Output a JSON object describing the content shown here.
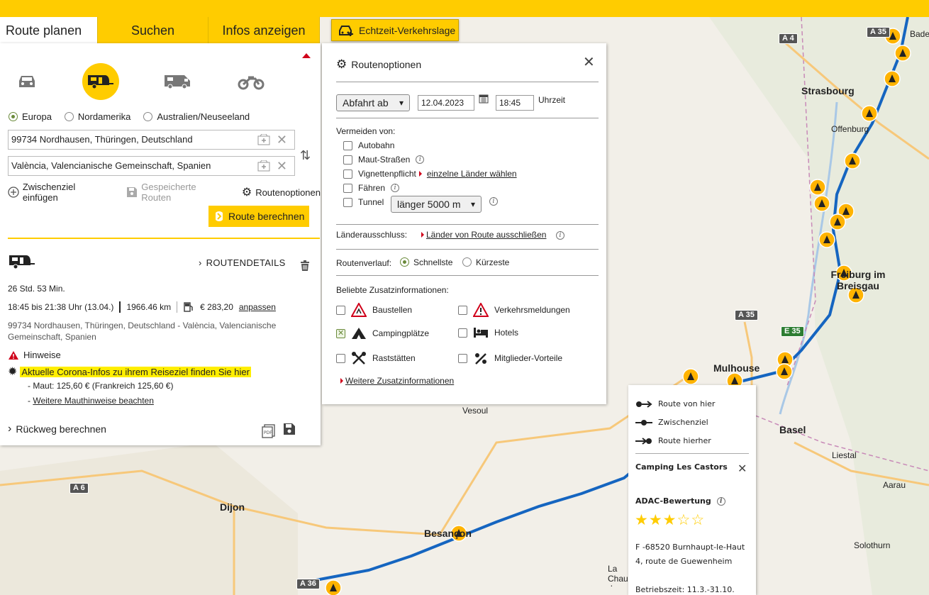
{
  "tabs": [
    {
      "label": "Route planen"
    },
    {
      "label": "Suchen"
    },
    {
      "label": "Infos anzeigen"
    }
  ],
  "traffic_button": {
    "label": "Echtzeit-Verkehrslage",
    "icon": "traffic-car-icon"
  },
  "planner": {
    "vehicles": [
      "car-icon",
      "caravan-icon",
      "motorhome-icon",
      "motorcycle-icon"
    ],
    "active_vehicle": "caravan",
    "regions": [
      "Europa",
      "Nordamerika",
      "Australien/Neuseeland"
    ],
    "selected_region": "Europa",
    "start": "99734 Nordhausen, Thüringen, Deutschland",
    "destination": "València, Valencianische Gemeinschaft, Spanien",
    "add_waypoint": "Zwischenziel einfügen",
    "saved_routes": "Gespeicherte Routen",
    "route_options": "Routenoptionen",
    "calculate": "Route berechnen"
  },
  "result": {
    "details_label": "ROUTENDETAILS",
    "duration": "26 Std. 53 Min.",
    "time_range": "18:45 bis 21:38 Uhr (13.04.)",
    "distance": "1966.46 km",
    "cost": "€ 283,20",
    "adjust": "anpassen",
    "description": "99734 Nordhausen, Thüringen, Deutschland - València, Valencianische Gemeinschaft, Spanien",
    "hints_label": "Hinweise",
    "corona": "Aktuelle Corona-Infos zu ihrem Reiseziel finden Sie hier",
    "toll_prefix": "- ",
    "toll": "Maut: 125,60 € (Frankreich 125,60 €)",
    "toll_more": "Weitere Mauthinweise beachten",
    "return_route": "Rückweg berechnen"
  },
  "options": {
    "title": "Routenoptionen",
    "departure_select": "Abfahrt ab",
    "date": "12.04.2023",
    "time": "18:45",
    "time_label": "Uhrzeit",
    "avoid_label": "Vermeiden von:",
    "avoid": [
      {
        "label": "Autobahn",
        "checked": false
      },
      {
        "label": "Maut-Straßen",
        "checked": false
      },
      {
        "label": "Vignettenpflicht",
        "checked": false
      },
      {
        "label": "Fähren",
        "checked": false
      },
      {
        "label": "Tunnel",
        "checked": false
      }
    ],
    "vignette_link": "einzelne Länder wählen",
    "tunnel_select": "länger 5000 m",
    "countries_label": "Länderausschluss:",
    "countries_link": "Länder von Route ausschließen",
    "course_label": "Routenverlauf:",
    "course_options": [
      "Schnellste",
      "Kürzeste"
    ],
    "course_selected": "Schnellste",
    "extras_label": "Beliebte Zusatzinformationen:",
    "extras": [
      {
        "label": "Baustellen",
        "checked": false,
        "icon": "construction-icon"
      },
      {
        "label": "Verkehrsmeldungen",
        "checked": false,
        "icon": "warning-triangle-icon"
      },
      {
        "label": "Campingplätze",
        "checked": true,
        "icon": "tent-icon"
      },
      {
        "label": "Hotels",
        "checked": false,
        "icon": "bed-icon"
      },
      {
        "label": "Raststätten",
        "checked": false,
        "icon": "fork-knife-icon"
      },
      {
        "label": "Mitglieder-Vorteile",
        "checked": false,
        "icon": "percent-icon"
      }
    ],
    "more_link": "Weitere Zusatzinformationen"
  },
  "popup": {
    "actions": [
      "Route von hier",
      "Zwischenziel",
      "Route hierher"
    ],
    "name": "Camping Les Castors",
    "rating_label": "ADAC-Bewertung",
    "rating": 3,
    "rating_max": 5,
    "address1": "F -68520 Burnhaupt-le-Haut",
    "address2": "4, route de Guewenheim",
    "hours": "Betriebszeit: 11.3.-31.10."
  },
  "map": {
    "cities": [
      "Strasbourg",
      "Offenburg",
      "Freiburg im Breisgau",
      "Mulhouse",
      "Basel",
      "Liestal",
      "Aarau",
      "Solothurn",
      "Dijon",
      "Besançon",
      "Vesoul",
      "La Chaux-de-Fonds",
      "Baden"
    ],
    "roads": [
      "A 4",
      "A 35",
      "A 35",
      "E 35",
      "A 6",
      "A 36"
    ],
    "route_color": "#1565c0",
    "accent": "#ffcc00"
  }
}
